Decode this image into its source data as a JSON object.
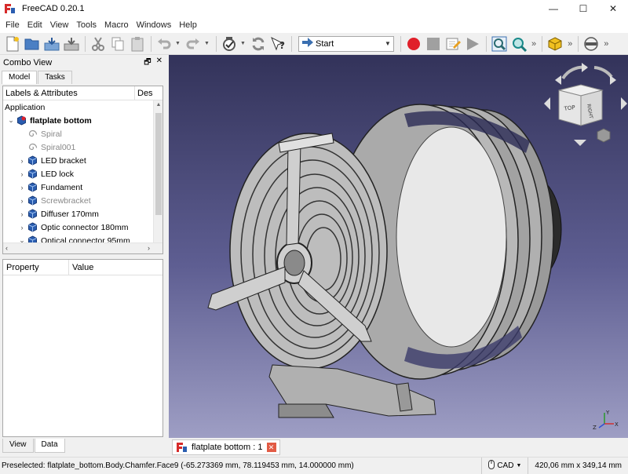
{
  "window": {
    "title": "FreeCAD 0.20.1",
    "controls": {
      "minimize": "—",
      "maximize": "☐",
      "close": "✕"
    }
  },
  "menu": [
    "File",
    "Edit",
    "View",
    "Tools",
    "Macro",
    "Windows",
    "Help"
  ],
  "toolbar": {
    "workbench": "Start",
    "more": "»"
  },
  "combo_view": {
    "title": "Combo View",
    "float_btn": "🗗",
    "close_btn": "✕",
    "tabs": [
      "Model",
      "Tasks"
    ],
    "tree_headers": [
      "Labels & Attributes",
      "Des"
    ],
    "root": "Application",
    "items": [
      {
        "label": "flatplate bottom",
        "expander": "⌄",
        "icon": "body-icon",
        "bold": true,
        "indent": 0
      },
      {
        "label": "Spiral",
        "expander": "",
        "icon": "spiral-icon",
        "dim": true,
        "indent": 1
      },
      {
        "label": "Spiral001",
        "expander": "",
        "icon": "spiral-icon",
        "dim": true,
        "indent": 1
      },
      {
        "label": "LED bracket",
        "expander": "›",
        "icon": "part-icon",
        "indent": 1
      },
      {
        "label": "LED lock",
        "expander": "›",
        "icon": "part-icon",
        "indent": 1
      },
      {
        "label": "Fundament",
        "expander": "›",
        "icon": "part-icon",
        "indent": 1
      },
      {
        "label": "Screwbracket",
        "expander": "›",
        "icon": "part-icon",
        "dim": true,
        "indent": 1
      },
      {
        "label": "Diffuser 170mm",
        "expander": "›",
        "icon": "part-icon",
        "indent": 1
      },
      {
        "label": "Optic connector 180mm",
        "expander": "›",
        "icon": "part-icon",
        "indent": 1
      },
      {
        "label": "Optical connector 95mm",
        "expander": "⌄",
        "icon": "part-icon",
        "indent": 1
      }
    ],
    "property_headers": [
      "Property",
      "Value"
    ],
    "bottom_tabs": [
      "View",
      "Data"
    ]
  },
  "viewport": {
    "nav_cube": {
      "front": "RIGHT",
      "top": "TOP"
    },
    "axes": {
      "x": "X",
      "y": "Y",
      "z": "Z"
    }
  },
  "document_tab": {
    "label": "flatplate bottom : 1",
    "close": "✕"
  },
  "status": {
    "preselected": "Preselected: flatplate_bottom.Body.Chamfer.Face9 (-65.273369 mm, 78.119453 mm, 14.000000 mm)",
    "nav_style": "CAD",
    "dimensions": "420,06 mm x 349,14 mm"
  },
  "colors": {
    "accent_red": "#e0202a",
    "model_gray": "#a8a8a8",
    "bg_top": "#33335a",
    "bg_bottom": "#9e9ec4"
  }
}
